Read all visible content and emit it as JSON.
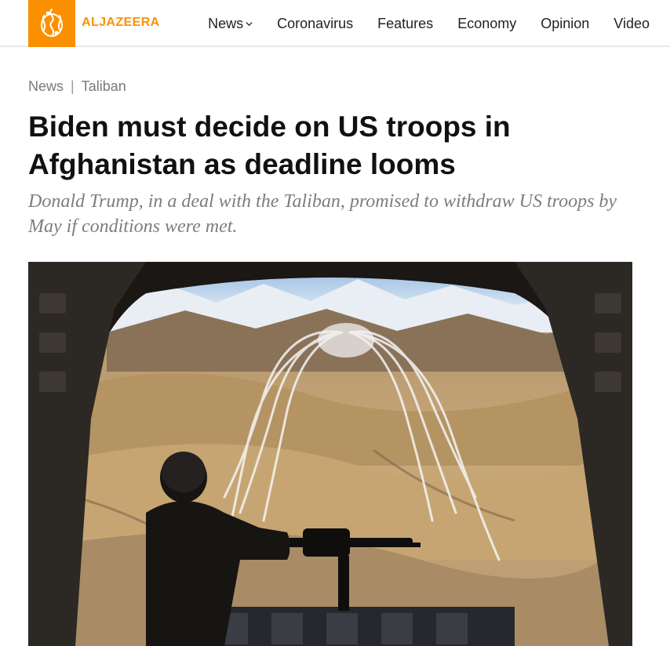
{
  "header": {
    "logo_text": "ALJAZEERA",
    "brand_color": "#fa9000",
    "nav": [
      {
        "label": "News",
        "has_dropdown": true
      },
      {
        "label": "Coronavirus"
      },
      {
        "label": "Features"
      },
      {
        "label": "Economy"
      },
      {
        "label": "Opinion"
      },
      {
        "label": "Video"
      }
    ]
  },
  "breadcrumb": {
    "items": [
      "News",
      "Taliban"
    ],
    "separator": "|"
  },
  "article": {
    "title": "Biden must decide on US troops in Afghanistan as deadline looms",
    "subtitle": "Donald Trump, in a deal with the Taliban, promised to withdraw US troops by May if conditions were met."
  }
}
